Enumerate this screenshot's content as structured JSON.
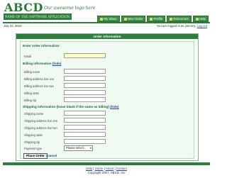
{
  "header": {
    "logo": "ABCD",
    "tagline": "Our awesome logo here",
    "software_name": "NAME OF THE SOFTWARE APPLICATION",
    "nav": [
      {
        "label": "My Inbox",
        "icon": "inbox-icon"
      },
      {
        "label": "New Order",
        "icon": "new-order-icon"
      },
      {
        "label": "Profile",
        "icon": "profile-icon"
      },
      {
        "label": "Resources",
        "icon": "resources-icon"
      },
      {
        "label": "Help",
        "icon": "help-icon"
      }
    ]
  },
  "status": {
    "date": "July 22, 2010",
    "login_text": "You are logged in as jimmmy.",
    "logout": "Log out"
  },
  "form": {
    "title": "Order information",
    "enter_heading": "Enter order information:",
    "email_label": "Email",
    "billing_heading": "Billing information",
    "billing_hide": "(hide)",
    "billing_fields": [
      "Billing name",
      "Billing address line one",
      "Billing address line two",
      "Billing state",
      "Billing zip"
    ],
    "shipping_heading": "Shipping information (leave blank if the same as billing)",
    "shipping_hide": "(hide)",
    "shipping_fields": [
      "Shipping name",
      "Shipping address line one",
      "Shipping address line two",
      "Shipping state",
      "Shipping zip"
    ],
    "payment_label": "Payment type",
    "payment_selected": "Please select...",
    "place_order": "Place Order",
    "cancel": "Cancel"
  },
  "footer": {
    "links": [
      "Help",
      "Home",
      "About",
      "Contact"
    ],
    "copyright": "Copyright 2007, ABCD, Inc"
  },
  "colors": {
    "brand_green": "#2f7d3c",
    "link_blue": "#1c4f9c",
    "email_field_bg": "#ffffc4"
  }
}
